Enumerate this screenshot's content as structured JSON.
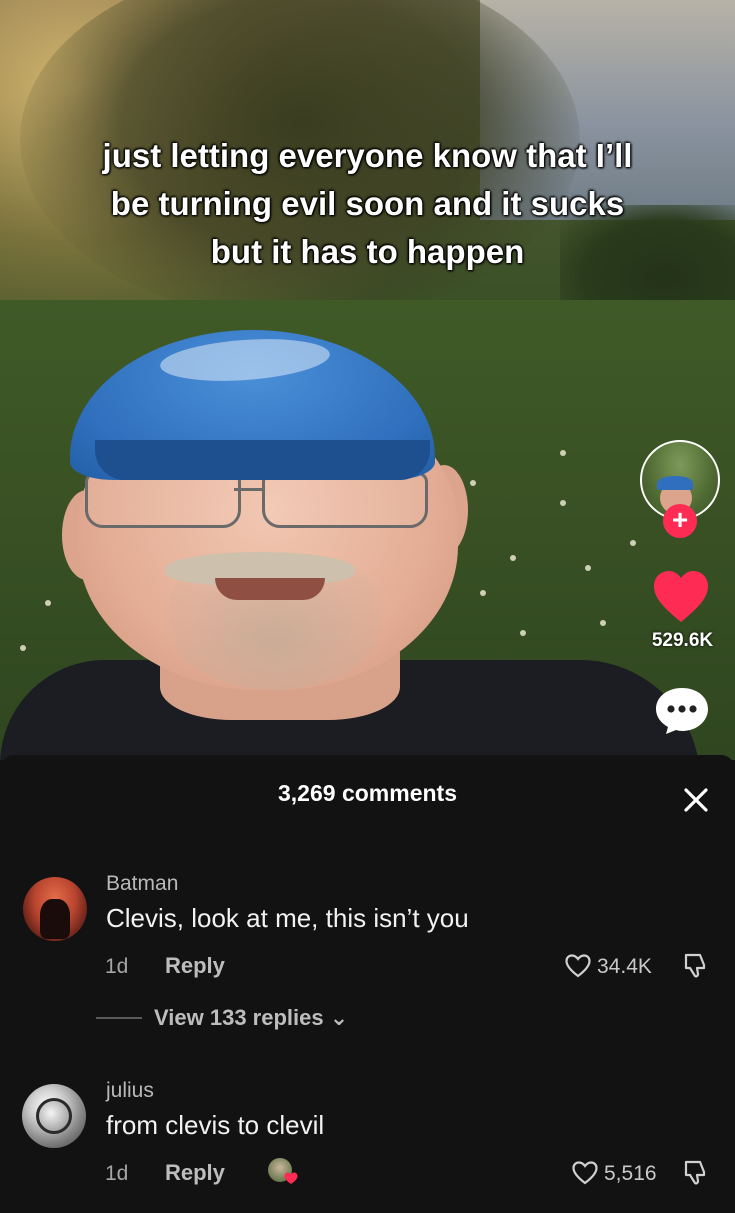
{
  "video": {
    "caption": "just letting everyone know that I’ll be turning evil soon and it sucks but it has to happen",
    "like_count": "529.6K"
  },
  "rail": {
    "follow_symbol": "+"
  },
  "comments_sheet": {
    "title": "3,269 comments",
    "close_symbol": "×",
    "comments": [
      {
        "user": "Batman",
        "text": "Clevis, look at me, this isn’t you",
        "time": "1d",
        "reply_label": "Reply",
        "likes": "34.4K",
        "view_replies": "View 133 replies ⌄"
      },
      {
        "user": "julius",
        "text": "from clevis to clevil",
        "time": "1d",
        "reply_label": "Reply",
        "likes": "5,516"
      }
    ]
  },
  "colors": {
    "accent_red": "#fe2c55",
    "sheet_bg": "#121212"
  }
}
